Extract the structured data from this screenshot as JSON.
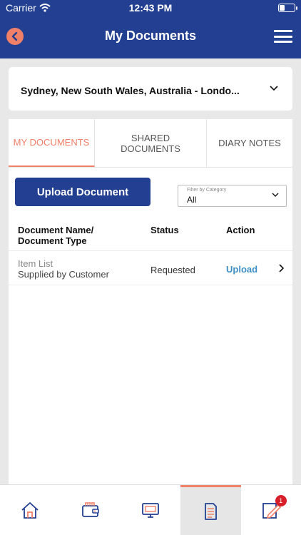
{
  "status_bar": {
    "carrier": "Carrier",
    "time": "12:43 PM"
  },
  "header": {
    "title": "My Documents"
  },
  "location": {
    "selected": "Sydney, New South Wales, Australia - Londo..."
  },
  "tabs": [
    {
      "label": "My Documents",
      "active": true
    },
    {
      "label": "Shared Documents",
      "active": false
    },
    {
      "label": "Diary Notes",
      "active": false
    }
  ],
  "upload_button": {
    "label": "Upload Document"
  },
  "filter": {
    "label": "Filter by Category",
    "value": "All"
  },
  "table": {
    "headers": {
      "name_line1": "Document Name/",
      "name_line2": "Document Type",
      "status": "Status",
      "action": "Action"
    },
    "rows": [
      {
        "name": "Item List",
        "type": "Supplied by Customer",
        "status": "Requested",
        "action": "Upload"
      }
    ]
  },
  "bottom_nav": {
    "items": [
      {
        "icon": "home-icon"
      },
      {
        "icon": "wallet-icon"
      },
      {
        "icon": "monitor-icon"
      },
      {
        "icon": "documents-icon",
        "active": true
      },
      {
        "icon": "edit-icon",
        "badge": "1"
      }
    ]
  },
  "colors": {
    "primary": "#233f91",
    "accent": "#f08068",
    "link": "#3d8fc6",
    "badge": "#d61f28"
  }
}
